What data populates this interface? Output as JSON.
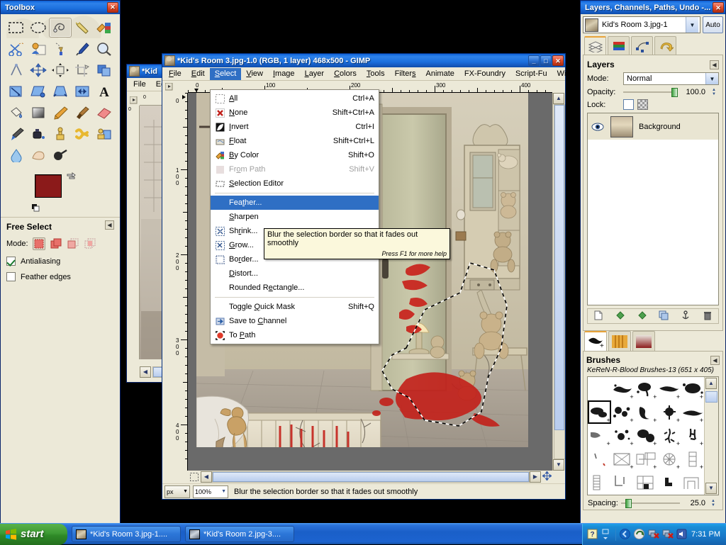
{
  "toolbox": {
    "title": "Toolbox",
    "close_label": "x",
    "tools": [
      {
        "name": "rect-select-tool",
        "label": "Rectangle Select"
      },
      {
        "name": "ellipse-select-tool",
        "label": "Ellipse Select"
      },
      {
        "name": "free-select-tool",
        "label": "Free Select"
      },
      {
        "name": "fuzzy-select-tool",
        "label": "Fuzzy Select"
      },
      {
        "name": "select-by-color-tool",
        "label": "Select by Color"
      },
      {
        "name": "scissors-select-tool",
        "label": "Scissors Select"
      },
      {
        "name": "foreground-select-tool",
        "label": "Foreground Select"
      },
      {
        "name": "paths-tool",
        "label": "Paths"
      },
      {
        "name": "color-picker-tool",
        "label": "Color Picker"
      },
      {
        "name": "zoom-tool",
        "label": "Zoom"
      },
      {
        "name": "measure-tool",
        "label": "Measure"
      },
      {
        "name": "move-tool",
        "label": "Move"
      },
      {
        "name": "align-tool",
        "label": "Alignment"
      },
      {
        "name": "crop-tool",
        "label": "Crop"
      },
      {
        "name": "rotate-tool",
        "label": "Rotate"
      },
      {
        "name": "scale-tool",
        "label": "Scale"
      },
      {
        "name": "shear-tool",
        "label": "Shear"
      },
      {
        "name": "perspective-tool",
        "label": "Perspective"
      },
      {
        "name": "flip-tool",
        "label": "Flip"
      },
      {
        "name": "text-tool",
        "label": "Text"
      },
      {
        "name": "bucket-fill-tool",
        "label": "Bucket Fill"
      },
      {
        "name": "blend-tool",
        "label": "Blend"
      },
      {
        "name": "pencil-tool",
        "label": "Pencil"
      },
      {
        "name": "paintbrush-tool",
        "label": "Paintbrush"
      },
      {
        "name": "eraser-tool",
        "label": "Eraser"
      },
      {
        "name": "airbrush-tool",
        "label": "Airbrush"
      },
      {
        "name": "ink-tool",
        "label": "Ink"
      },
      {
        "name": "clone-tool",
        "label": "Clone"
      },
      {
        "name": "heal-tool",
        "label": "Heal"
      },
      {
        "name": "perspective-clone-tool",
        "label": "Perspective Clone"
      },
      {
        "name": "blur-sharpen-tool",
        "label": "Blur / Sharpen"
      },
      {
        "name": "smudge-tool",
        "label": "Smudge"
      },
      {
        "name": "dodge-burn-tool",
        "label": "Dodge / Burn"
      }
    ],
    "selected_tool_index": 2,
    "colors": {
      "foreground": "#8b1a1a",
      "background": "#ffffff"
    },
    "options": {
      "title": "Free Select",
      "mode_label": "Mode:",
      "mode_selected_index": 0,
      "antialiasing_label": "Antialiasing",
      "antialiasing_checked": true,
      "feather_label": "Feather edges",
      "feather_checked": false
    }
  },
  "bgwindow": {
    "title": "*Kid",
    "menu": [
      "File",
      "Ed"
    ]
  },
  "mainwindow": {
    "title": "*Kid's Room 3.jpg-1.0 (RGB, 1 layer) 468x500 - GIMP",
    "buttons": {
      "minimize": "_",
      "maximize": "□",
      "close": "✕"
    },
    "menu": [
      "File",
      "Edit",
      "Select",
      "View",
      "Image",
      "Layer",
      "Colors",
      "Tools",
      "Filters",
      "Animate",
      "FX-Foundry",
      "Script-Fu",
      "Wind"
    ],
    "active_menu": "Select",
    "ruler_h_ticks": [
      "0",
      "100",
      "200",
      "300",
      "400"
    ],
    "ruler_v_ticks": [
      "0",
      "100",
      "200",
      "300",
      "400"
    ],
    "statusbar": {
      "unit": "px",
      "zoom": "100%",
      "message": "Blur the selection border so that it fades out smoothly"
    }
  },
  "select_menu": {
    "items": [
      {
        "icon": "select-all-icon",
        "label": "All",
        "accel": "Ctrl+A",
        "state": "normal"
      },
      {
        "icon": "select-none-icon",
        "label": "None",
        "accel": "Shift+Ctrl+A",
        "state": "normal"
      },
      {
        "icon": "select-invert-icon",
        "label": "Invert",
        "accel": "Ctrl+I",
        "state": "normal"
      },
      {
        "icon": "select-float-icon",
        "label": "Float",
        "accel": "Shift+Ctrl+L",
        "state": "normal"
      },
      {
        "icon": "select-by-color-icon",
        "label": "By Color",
        "accel": "Shift+O",
        "state": "normal"
      },
      {
        "icon": "select-from-path-icon",
        "label": "From Path",
        "accel": "Shift+V",
        "state": "disabled"
      },
      {
        "icon": "selection-editor-icon",
        "label": "Selection Editor",
        "accel": "",
        "state": "normal"
      },
      {
        "separator": true
      },
      {
        "icon": "",
        "label": "Feather...",
        "accel": "",
        "state": "highlighted"
      },
      {
        "icon": "",
        "label": "Sharpen",
        "accel": "",
        "state": "normal"
      },
      {
        "icon": "select-shrink-icon",
        "label": "Shrink...",
        "accel": "",
        "state": "normal"
      },
      {
        "icon": "select-grow-icon",
        "label": "Grow...",
        "accel": "",
        "state": "normal"
      },
      {
        "icon": "select-border-icon",
        "label": "Border...",
        "accel": "",
        "state": "normal"
      },
      {
        "icon": "",
        "label": "Distort...",
        "accel": "",
        "state": "normal"
      },
      {
        "icon": "",
        "label": "Rounded Rectangle...",
        "accel": "",
        "state": "normal"
      },
      {
        "separator": true
      },
      {
        "icon": "",
        "label": "Toggle Quick Mask",
        "accel": "Shift+Q",
        "state": "normal"
      },
      {
        "icon": "save-to-channel-icon",
        "label": "Save to Channel",
        "accel": "",
        "state": "normal"
      },
      {
        "icon": "to-path-icon",
        "label": "To Path",
        "accel": "",
        "state": "normal"
      }
    ]
  },
  "tooltip": {
    "text": "Blur the selection border so that it fades out smoothly",
    "hint": "Press F1 for more help"
  },
  "dock": {
    "title": "Layers, Channels, Paths, Undo -...",
    "image_name": "Kid's Room 3.jpg-1",
    "auto_label": "Auto",
    "tabs": [
      {
        "name": "layers-tab",
        "label": "Layers"
      },
      {
        "name": "channels-tab",
        "label": "Channels"
      },
      {
        "name": "paths-tab",
        "label": "Paths"
      },
      {
        "name": "undo-history-tab",
        "label": "Undo History"
      }
    ],
    "active_tab_index": 0,
    "layers_panel": {
      "heading": "Layers",
      "mode_label": "Mode:",
      "mode_value": "Normal",
      "opacity_label": "Opacity:",
      "opacity_value": "100.0",
      "lock_label": "Lock:",
      "layers": [
        {
          "name": "Background",
          "visible": true
        }
      ]
    },
    "layer_buttons": [
      {
        "name": "new-layer-button"
      },
      {
        "name": "raise-layer-button"
      },
      {
        "name": "lower-layer-button"
      },
      {
        "name": "duplicate-layer-button"
      },
      {
        "name": "anchor-layer-button"
      },
      {
        "name": "delete-layer-button"
      }
    ],
    "brush_tabs": [
      {
        "name": "brushes-tab",
        "label": "Brushes"
      },
      {
        "name": "patterns-tab",
        "label": "Patterns"
      },
      {
        "name": "gradients-tab",
        "label": "Gradients"
      }
    ],
    "brush_active_tab_index": 0,
    "brushes_panel": {
      "heading": "Brushes",
      "selected_brush": "KeReN-R-Blood Brushes-13 (651 x 405)",
      "spacing_label": "Spacing:",
      "spacing_value": "25.0",
      "selected_index": 5
    }
  },
  "taskbar": {
    "start_label": "start",
    "tasks": [
      {
        "name": "taskbar-item-kids-room-3",
        "label": "*Kid's Room 3.jpg-1...."
      },
      {
        "name": "taskbar-item-kids-room-2",
        "label": "*Kid's Room 2.jpg-3...."
      }
    ],
    "clock": "7:31 PM"
  }
}
